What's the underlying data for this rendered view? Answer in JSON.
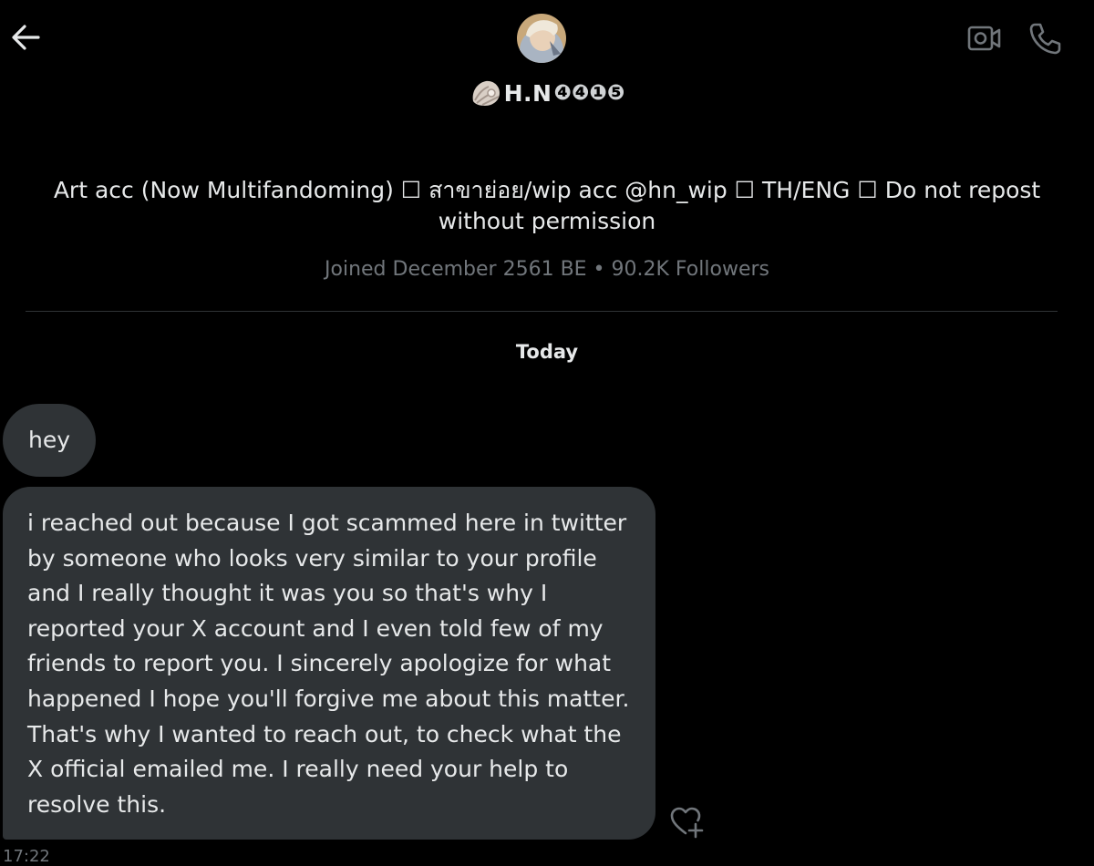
{
  "header": {
    "back_icon": "arrow-left-icon",
    "video_icon": "video-camera-icon",
    "call_icon": "phone-icon"
  },
  "profile": {
    "display_name": "H.N",
    "name_badge_icon": "shell-icon",
    "name_suffix": "❹❹❶❺",
    "bio": "Art acc (Now Multifandoming) ☐ สาขาย่อย/wip acc @hn_wip ☐ TH/ENG ☐ Do not repost without permission",
    "meta": "Joined December 2561 BE • 90.2K Followers"
  },
  "conversation": {
    "date_separator": "Today",
    "messages": [
      {
        "text": "hey"
      },
      {
        "text": "i  reached out because I got scammed here in twitter by someone who looks very similar to your profile and I really thought it was you so that's why I reported your X account and I even told few of my friends to report you. I sincerely apologize for what happened I hope you'll forgive me about this matter. That's why I wanted to reach out, to check what the X official emailed me. I really need your help to resolve this."
      }
    ],
    "react_icon": "heart-plus-icon",
    "timestamp": "17:22"
  },
  "colors": {
    "background": "#000000",
    "bubble": "#2f3336",
    "text": "#e7e9ea",
    "muted": "#71767b",
    "divider": "#2f3336"
  }
}
